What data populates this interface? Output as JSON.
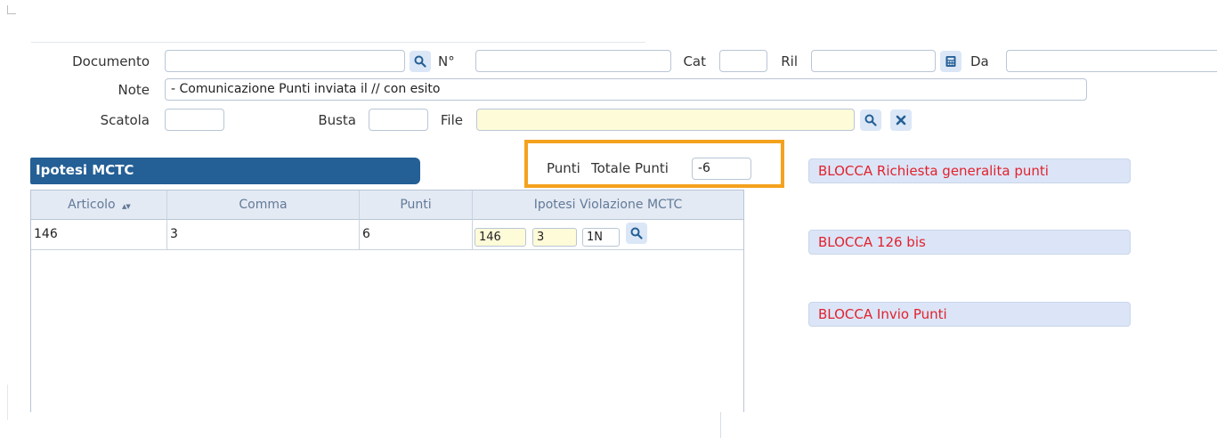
{
  "form": {
    "documento_label": "Documento",
    "documento_value": "",
    "numero_label": "N°",
    "numero_value": "",
    "cat_label": "Cat",
    "cat_value": "",
    "ril_label": "Ril",
    "ril_value": "",
    "da_label": "Da",
    "da_value": "",
    "note_label": "Note",
    "note_value": "- Comunicazione Punti inviata il // con esito",
    "scatola_label": "Scatola",
    "scatola_value": "",
    "busta_label": "Busta",
    "busta_value": "",
    "file_label": "File",
    "file_value": ""
  },
  "section": {
    "title": "Ipotesi MCTC"
  },
  "punti": {
    "punti_label": "Punti",
    "totale_label": "Totale Punti",
    "totale_value": "-6"
  },
  "grid": {
    "columns": [
      "Articolo",
      "Comma",
      "Punti",
      "Ipotesi Violazione MCTC"
    ],
    "sort_indicator": "▲▼",
    "rows": [
      {
        "articolo": "146",
        "comma": "3",
        "punti": "6",
        "ipotesi": {
          "articolo": "146",
          "comma": "3",
          "codice": "1N"
        }
      }
    ]
  },
  "actions": {
    "blocca_richiesta": "BLOCCA Richiesta generalita punti",
    "blocca_126bis": "BLOCCA 126 bis",
    "blocca_invio": "BLOCCA Invio Punti"
  },
  "icons": {
    "search": "search-icon",
    "calculator": "calculator-icon",
    "clear": "close-icon"
  },
  "colors": {
    "section_header_bg": "#245f95",
    "highlight_frame": "#f4a21d",
    "blocca_text": "#e2222d",
    "blocca_bg": "#dbe5f7",
    "file_field_bg": "#fdfbd8"
  }
}
